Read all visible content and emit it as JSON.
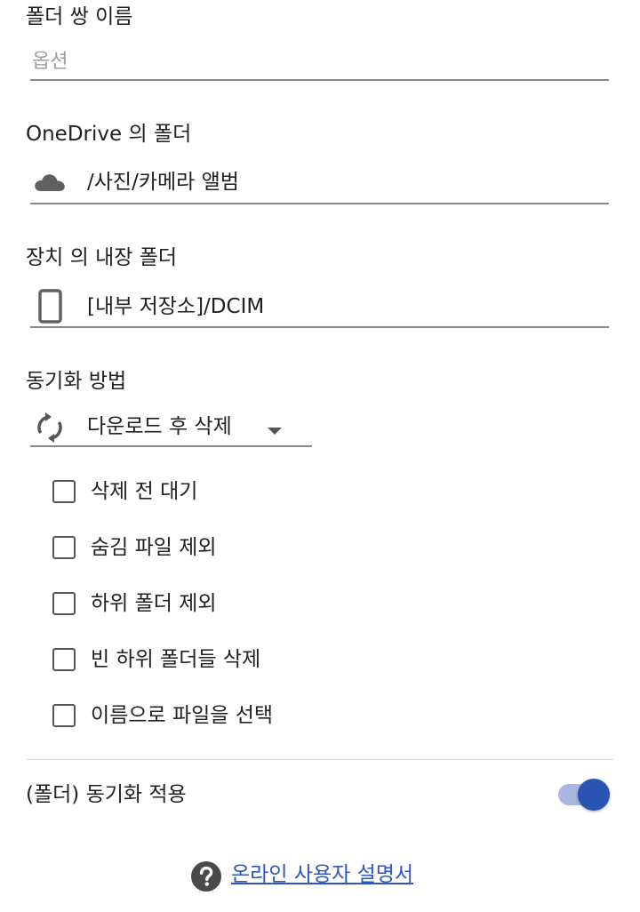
{
  "folder_pair_name": {
    "label": "폴더 쌍 이름",
    "placeholder": "옵션",
    "value": ""
  },
  "onedrive_folder": {
    "label": "OneDrive 의 폴더",
    "icon": "cloud-icon",
    "value": "/사진/카메라 앨범"
  },
  "device_folder": {
    "label": "장치 의 내장 폴더",
    "icon": "phone-icon",
    "value": "[내부 저장소]/DCIM"
  },
  "sync_method": {
    "label": "동기화 방법",
    "icon": "sync-icon",
    "selected": "다운로드 후 삭제"
  },
  "options": [
    {
      "label": "삭제 전 대기",
      "checked": false
    },
    {
      "label": "숨김 파일 제외",
      "checked": false
    },
    {
      "label": "하위 폴더 제외",
      "checked": false
    },
    {
      "label": "빈 하위 폴더들 삭제",
      "checked": false
    },
    {
      "label": "이름으로 파일을 선택",
      "checked": false
    }
  ],
  "apply_sync": {
    "label": "(폴더) 동기화 적용",
    "enabled": true
  },
  "help": {
    "icon": "help-icon",
    "link_text": "온라인 사용자 설명서"
  },
  "colors": {
    "accent": "#2a54b3",
    "toggle_track": "#a9b6df",
    "link": "#2f55c0",
    "underline": "#8a8a8a"
  }
}
